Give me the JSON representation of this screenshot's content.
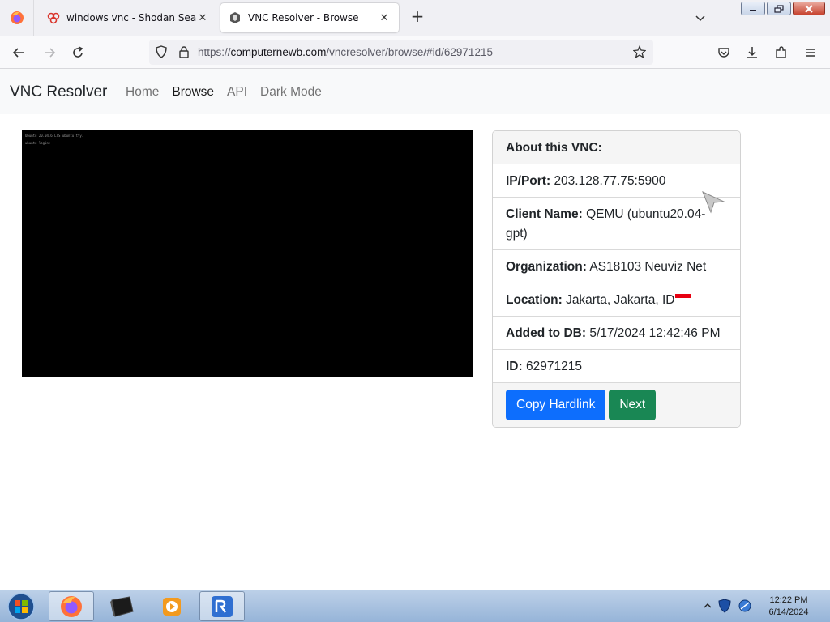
{
  "browser": {
    "tabs": [
      {
        "label": "windows vnc - Shodan Search",
        "icon": "shodan-icon"
      },
      {
        "label": "VNC Resolver - Browse",
        "icon": "vnc-resolver-icon"
      }
    ],
    "url": {
      "scheme": "https://",
      "host": "computernewb.com",
      "path": "/vncresolver/browse/#id/62971215"
    }
  },
  "site": {
    "brand": "VNC Resolver",
    "nav": [
      "Home",
      "Browse",
      "API",
      "Dark Mode"
    ],
    "active_nav": "Browse"
  },
  "screenshot": {
    "lines": [
      "Ubuntu 20.04.6 LTS ubuntu tty1",
      "ubuntu login:"
    ]
  },
  "details": {
    "header": "About this VNC:",
    "rows": [
      {
        "label": "IP/Port:",
        "value": "203.128.77.75:5900"
      },
      {
        "label": "Client Name:",
        "value": "QEMU (ubuntu20.04-gpt)"
      },
      {
        "label": "Organization:",
        "value": "AS18103 Neuviz Net"
      },
      {
        "label": "Location:",
        "value": "Jakarta, Jakarta, ID",
        "flag": "Indonesia"
      },
      {
        "label": "Added to DB:",
        "value": "5/17/2024 12:42:46 PM"
      },
      {
        "label": "ID:",
        "value": "62971215"
      }
    ],
    "buttons": {
      "copy": "Copy Hardlink",
      "next": "Next"
    }
  },
  "taskbar": {
    "apps": [
      "firefox-icon",
      "terminal-icon",
      "media-player-icon",
      "vnc-resolver-app-icon"
    ],
    "time": "12:22 PM",
    "date": "6/14/2024"
  },
  "colors": {
    "primary": "#0d6efd",
    "success": "#198754",
    "navbar_bg": "#f8f9fa"
  }
}
